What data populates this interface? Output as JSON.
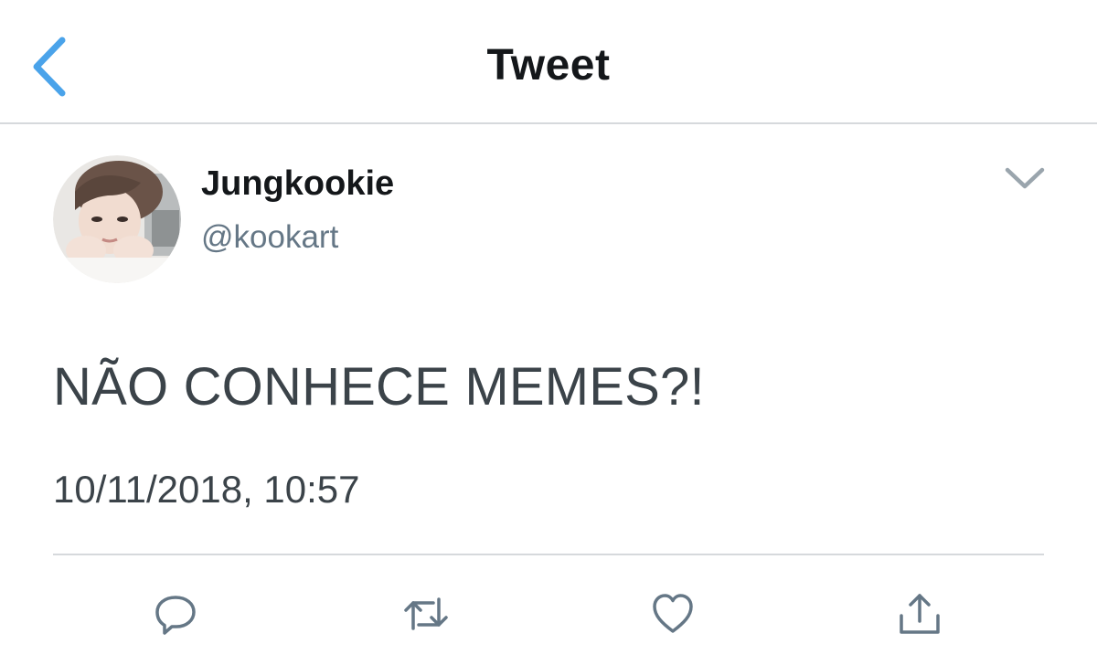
{
  "nav": {
    "title": "Tweet",
    "back_icon": "chevron-left-icon"
  },
  "tweet": {
    "display_name": "Jungkookie",
    "handle": "@kookart",
    "text": "NÃO CONHECE MEMES?!",
    "timestamp": "10/11/2018, 10:57",
    "menu_icon": "chevron-down-icon"
  },
  "actions": [
    {
      "name": "reply",
      "icon": "reply-icon"
    },
    {
      "name": "retweet",
      "icon": "retweet-icon"
    },
    {
      "name": "like",
      "icon": "heart-icon"
    },
    {
      "name": "share",
      "icon": "share-icon"
    }
  ],
  "colors": {
    "accent": "#4aa3ea",
    "text_primary": "#14171a",
    "text_secondary": "#657786",
    "icon_gray": "#657786",
    "divider": "#d6d9dc"
  }
}
